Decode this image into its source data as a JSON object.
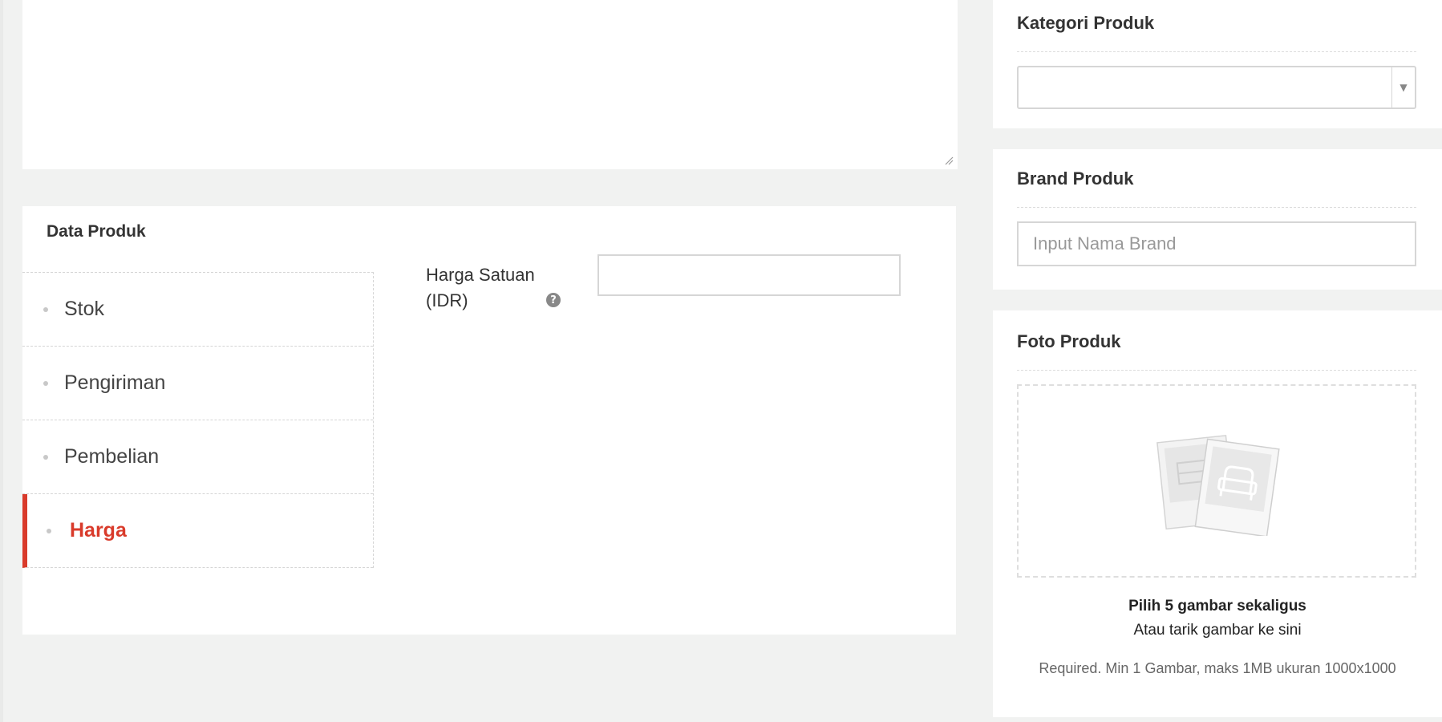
{
  "data_produk": {
    "title": "Data Produk",
    "tabs": [
      {
        "label": "Stok",
        "active": false
      },
      {
        "label": "Pengiriman",
        "active": false
      },
      {
        "label": "Pembelian",
        "active": false
      },
      {
        "label": "Harga",
        "active": true
      }
    ],
    "price_field": {
      "label_line1": "Harga Satuan",
      "label_line2": "(IDR)",
      "help_icon": "question-circle-icon",
      "value": ""
    }
  },
  "kategori": {
    "title": "Kategori Produk",
    "selected_value": ""
  },
  "brand": {
    "title": "Brand Produk",
    "placeholder": "Input Nama Brand",
    "value": ""
  },
  "foto": {
    "title": "Foto Produk",
    "primary_text": "Pilih 5 gambar sekaligus",
    "secondary_text": "Atau tarik gambar ke sini",
    "note": "Required. Min 1 Gambar, maks 1MB ukuran 1000x1000"
  },
  "colors": {
    "accent": "#d93b2b",
    "background": "#f1f2f1",
    "card": "#ffffff"
  }
}
